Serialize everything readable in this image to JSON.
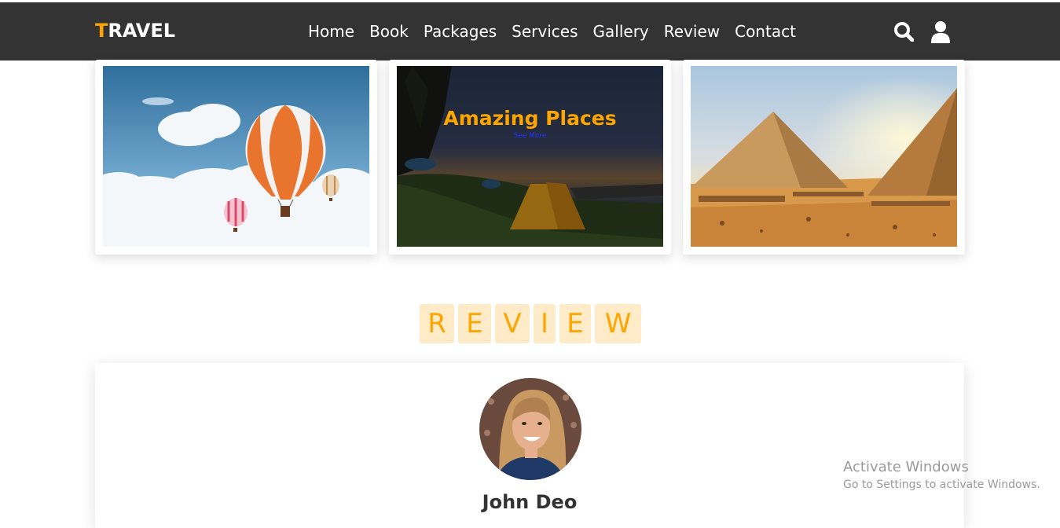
{
  "header": {
    "logo_first": "T",
    "logo_rest": "RAVEL",
    "nav": [
      "Home",
      "Book",
      "Packages",
      "Services",
      "Gallery",
      "Review",
      "Contact"
    ],
    "icons": [
      "search-icon",
      "user-icon"
    ]
  },
  "gallery": {
    "overlay_title": "Amazing Places",
    "overlay_link": "See More"
  },
  "review": {
    "heading_letters": [
      "R",
      "E",
      "V",
      "I",
      "E",
      "W"
    ],
    "name": "John Deo"
  },
  "watermark": {
    "line1": "Activate Windows",
    "line2": "Go to Settings to activate Windows."
  },
  "colors": {
    "accent": "#ffa500",
    "nav_bg": "#333333",
    "link": "#2233ff"
  }
}
